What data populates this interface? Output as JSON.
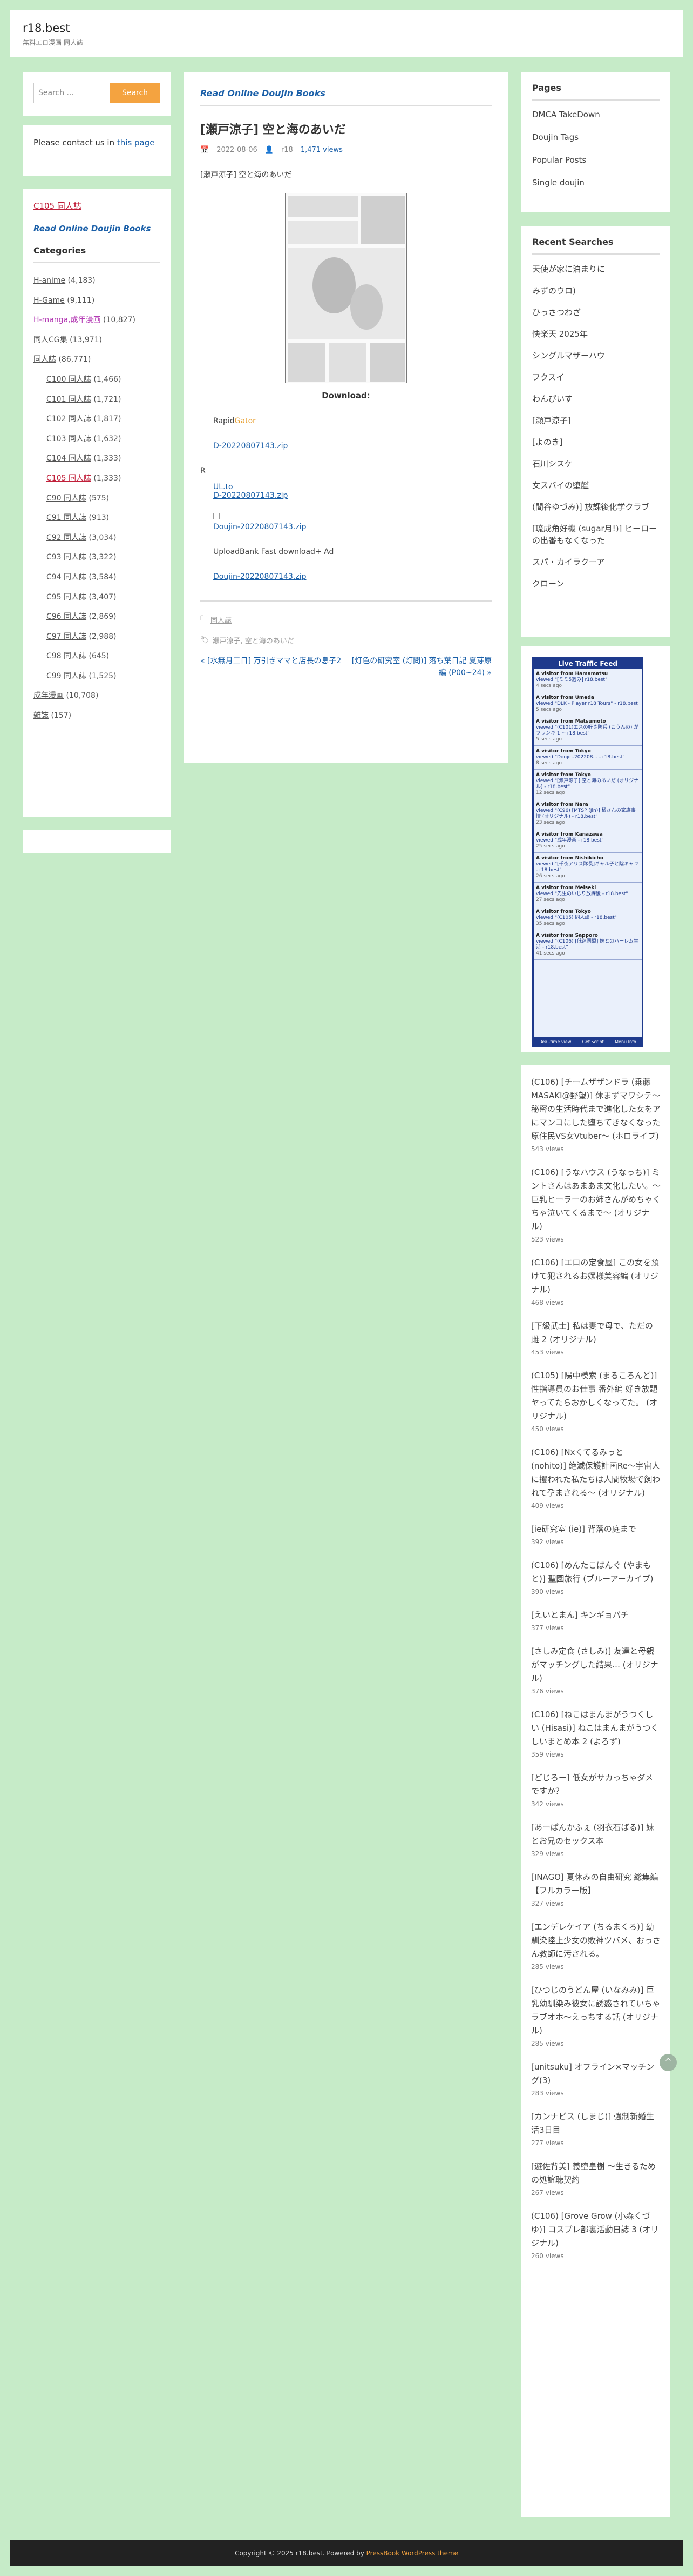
{
  "site": {
    "title": "r18.best",
    "description": "無料エロ漫画 同人誌"
  },
  "search": {
    "placeholder": "Search ...",
    "button": "Search"
  },
  "contact": {
    "before": "Please contact us in ",
    "link": "this page"
  },
  "left_links": {
    "c105": "C105 同人誌",
    "read_online": "Read Online Doujin Books"
  },
  "categories": {
    "heading": "Categories",
    "items": [
      {
        "label": "H-anime",
        "count": "(4,183)",
        "sub": false,
        "style": ""
      },
      {
        "label": "H-Game",
        "count": "(9,111)",
        "sub": false,
        "style": ""
      },
      {
        "label": "H-manga,成年漫画",
        "count": "(10,827)",
        "sub": false,
        "style": "magenta"
      },
      {
        "label": "同人CG集",
        "count": "(13,971)",
        "sub": false,
        "style": ""
      },
      {
        "label": "同人誌",
        "count": "(86,771)",
        "sub": false,
        "style": ""
      },
      {
        "label": "C100 同人誌",
        "count": "(1,466)",
        "sub": true,
        "style": ""
      },
      {
        "label": "C101 同人誌",
        "count": "(1,721)",
        "sub": true,
        "style": ""
      },
      {
        "label": "C102 同人誌",
        "count": "(1,817)",
        "sub": true,
        "style": ""
      },
      {
        "label": "C103 同人誌",
        "count": "(1,632)",
        "sub": true,
        "style": ""
      },
      {
        "label": "C104 同人誌",
        "count": "(1,333)",
        "sub": true,
        "style": ""
      },
      {
        "label": "C105 同人誌",
        "count": "(1,333)",
        "sub": true,
        "style": "red"
      },
      {
        "label": "C90 同人誌",
        "count": "(575)",
        "sub": true,
        "style": ""
      },
      {
        "label": "C91 同人誌",
        "count": "(913)",
        "sub": true,
        "style": ""
      },
      {
        "label": "C92 同人誌",
        "count": "(3,034)",
        "sub": true,
        "style": ""
      },
      {
        "label": "C93 同人誌",
        "count": "(3,322)",
        "sub": true,
        "style": ""
      },
      {
        "label": "C94 同人誌",
        "count": "(3,584)",
        "sub": true,
        "style": ""
      },
      {
        "label": "C95 同人誌",
        "count": "(3,407)",
        "sub": true,
        "style": ""
      },
      {
        "label": "C96 同人誌",
        "count": "(2,869)",
        "sub": true,
        "style": ""
      },
      {
        "label": "C97 同人誌",
        "count": "(2,988)",
        "sub": true,
        "style": ""
      },
      {
        "label": "C98 同人誌",
        "count": "(645)",
        "sub": true,
        "style": ""
      },
      {
        "label": "C99 同人誌",
        "count": "(1,525)",
        "sub": true,
        "style": ""
      },
      {
        "label": "成年漫画",
        "count": "(10,708)",
        "sub": false,
        "style": ""
      },
      {
        "label": "雑誌",
        "count": "(157)",
        "sub": false,
        "style": ""
      }
    ]
  },
  "post": {
    "category": "Read Online Doujin Books",
    "title": "[瀬戸涼子] 空と海のあいだ",
    "date": "2022-08-06",
    "author": "r18",
    "views": "1,471 views",
    "lead": "[瀬戸涼子] 空と海のあいだ",
    "download_label": "Download:",
    "rapid": "Rapid",
    "gator": "Gator",
    "file": "D-20220807143.zip",
    "r": "R",
    "ul": "UL.to",
    "file2": "D-20220807143.zip",
    "doujin_file": "Doujin-20220807143.zip",
    "uploadbank": "UploadBank Fast download+ Ad",
    "doujin_file2": "Doujin-20220807143.zip",
    "footer_cat": "同人誌",
    "footer_tags": "瀬戸涼子, 空と海のあいだ",
    "prev": "« [水無月三日] 万引きママと店長の息子2",
    "next": "[灯色の研究室 (灯問)] 落ち葉日記 夏芽原編 (P00~24) »"
  },
  "pages": {
    "heading": "Pages",
    "items": [
      "DMCA TakeDown",
      "Doujin Tags",
      "Popular Posts",
      "Single doujin"
    ]
  },
  "recent": {
    "heading": "Recent Searches",
    "items": [
      "天使が家に泊まりに",
      "みずのウロ)",
      "ひっさつわざ",
      "快楽天 2025年",
      "シングルマザーハウ",
      "フクスイ",
      "わんぴいす",
      "[瀬戸涼子]",
      "[よのき]",
      "石川シスケ",
      "女スパイの堕艦",
      "(間谷ゆづみ)] 放課後化学クラブ",
      "[琉成角好機 (sugar月!)] ヒーローの出番もなくなった",
      "スパ・カイラクーア",
      "クローン"
    ]
  },
  "feed": {
    "title": "Live Traffic Feed",
    "entries": [
      {
        "who": "A visitor from Hamamatsu",
        "what": "viewed \"[ミミ5週み] r18.best\"",
        "when": "4 secs ago"
      },
      {
        "who": "A visitor from Umeda",
        "what": "viewed \"DLK - Player r18 Tours\" - r18.best",
        "when": "5 secs ago"
      },
      {
        "who": "A visitor from Matsumoto",
        "what": "viewed \"(C101)エスの好き防兵 (こうんの) がフランキ 1 ~ r18.best\"",
        "when": "5 secs ago"
      },
      {
        "who": "A visitor from Tokyo",
        "what": "viewed \"Doujin-202208... - r18.best\"",
        "when": "8 secs ago"
      },
      {
        "who": "A visitor from Tokyo",
        "what": "viewed \"[瀬戸涼子] 空と海のあいだ (オリジナル) - r18.best\"",
        "when": "12 secs ago"
      },
      {
        "who": "A visitor from Nara",
        "what": "viewed \"(C96) [MTSP (Jin)] 橘さんの家族事情 (オリジナル) - r18.best\"",
        "when": "23 secs ago"
      },
      {
        "who": "A visitor from Kanazawa",
        "what": "viewed \"成年漫画 - r18.best\"",
        "when": "25 secs ago"
      },
      {
        "who": "A visitor from Nishikicho",
        "what": "viewed \"[千夜アリス隊長]ギャル子と陰キャ 2 - r18.best\"",
        "when": "26 secs ago"
      },
      {
        "who": "A visitor from Meiseki",
        "what": "viewed \"先生のいじり放課後 - r18.best\"",
        "when": "27 secs ago"
      },
      {
        "who": "A visitor from Tokyo",
        "what": "viewed \"(C105) 同人誌 - r18.best\"",
        "when": "35 secs ago"
      },
      {
        "who": "A visitor from Sapporo",
        "what": "viewed \"(C106) [低迷同盟] 妹とのハーレム生活 - r18.best\"",
        "when": "41 secs ago"
      }
    ],
    "footer": [
      "Real-time view",
      "Get Script",
      "Menu Info"
    ]
  },
  "popular": [
    {
      "t": "(C106) [チームザザンドラ (乗藤MASAKI@野望)] 休まずマワシテ〜秘密の生活時代まで進化した女をアにマンコにした堕ちてきなくなった原住民VS女Vtuber〜 (ホロライブ)",
      "v": "543 views"
    },
    {
      "t": "(C106) [うなハウス (うなっち)] ミントさんはあまあま文化したい。〜巨乳ヒーラーのお姉さんがめちゃくちゃ泣いてくるまで〜 (オリジナル)",
      "v": "523 views"
    },
    {
      "t": "(C106) [エロの定食屋] この女を預けて犯されるお嬢様美容編 (オリジナル)",
      "v": "468 views"
    },
    {
      "t": "[下級武士] 私は妻で母で、ただの雌 2 (オリジナル)",
      "v": "453 views"
    },
    {
      "t": "(C105) [陽中模索 (まるころんど)] 性指導員のお仕事 番外編 好き放題ヤってたらおかしくなってた。 (オリジナル)",
      "v": "450 views"
    },
    {
      "t": "(C106) [Nxくてるみっと (nohito)] 絶滅保護計画Re〜宇宙人に攫われた私たちは人間牧場で飼われて孕まされる〜 (オリジナル)",
      "v": "409 views"
    },
    {
      "t": "[ie研究室 (ie)] 背落の庭まで",
      "v": "392 views"
    },
    {
      "t": "(C106) [めんたこぱんぐ (やまもと)] 聖園旅行 (ブルーアーカイブ)",
      "v": "390 views"
    },
    {
      "t": "[えいとまん] キンギョバチ",
      "v": "377 views"
    },
    {
      "t": "[さしみ定食 (さしみ)] 友達と母親がマッチングした結果… (オリジナル)",
      "v": "376 views"
    },
    {
      "t": "(C106) [ねこはまんまがうつくしい (Hisasi)] ねこはまんまがうつくしいまとめ本 2 (よろず)",
      "v": "359 views"
    },
    {
      "t": "[どじろー] 低女がサカっちゃダメですか？",
      "v": "342 views"
    },
    {
      "t": "[あーぱんかふぇ (羽衣石ばる)] 妹とお兄のセックス本",
      "v": "329 views"
    },
    {
      "t": "[INAGO] 夏休みの自由研究 総集編【フルカラー版】",
      "v": "327 views"
    },
    {
      "t": "[エンデレケイア (ちるまくろ)] 幼馴染陸上少女の敗神ツバメ、おっさん教師に汚される。",
      "v": "285 views"
    },
    {
      "t": "[ひつじのうどん屋 (いなみみ)] 巨乳幼馴染み彼女に誘惑されていちゃラブオホ〜えっちする話 (オリジナル)",
      "v": "285 views"
    },
    {
      "t": "[unitsuku] オフライン×マッチング(3)",
      "v": "283 views"
    },
    {
      "t": "[カンナビス (しまじ)] 強制新婚生活3日目",
      "v": "277 views"
    },
    {
      "t": "[遊佐背美] 義堕皇樹 〜生きるための処誼聴契約",
      "v": "267 views"
    },
    {
      "t": "(C106) [Grove Grow (小森くづゆ)] コスプレ部裏活動日誌 3 (オリジナル)",
      "v": "260 views"
    }
  ],
  "footer": {
    "text": "Copyright © 2025 r18.best. Powered by ",
    "link": "PressBook WordPress theme"
  },
  "scroll_top": "^"
}
